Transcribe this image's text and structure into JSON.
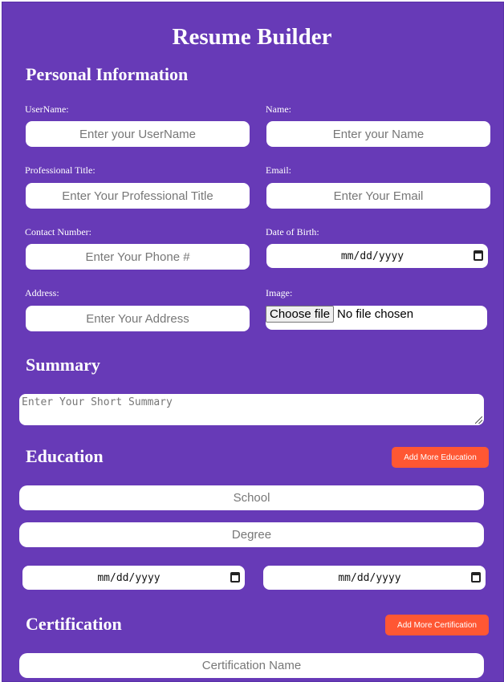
{
  "app": {
    "title": "Resume Builder"
  },
  "personal": {
    "heading": "Personal Information",
    "username": {
      "label": "UserName:",
      "placeholder": "Enter your UserName"
    },
    "name": {
      "label": "Name:",
      "placeholder": "Enter your Name"
    },
    "professional_title": {
      "label": "Professional Title:",
      "placeholder": "Enter Your Professional Title"
    },
    "email": {
      "label": "Email:",
      "placeholder": "Enter Your Email"
    },
    "contact": {
      "label": "Contact Number:",
      "placeholder": "Enter Your Phone #"
    },
    "dob": {
      "label": "Date of Birth:",
      "placeholder": "mm/dd/yyyy"
    },
    "address": {
      "label": "Address:",
      "placeholder": "Enter Your Address"
    },
    "image": {
      "label": "Image:",
      "button": "Choose file",
      "status": "No file chosen"
    }
  },
  "summary": {
    "heading": "Summary",
    "placeholder": "Enter Your Short Summary"
  },
  "education": {
    "heading": "Education",
    "add_button": "Add More Education",
    "school_placeholder": "School",
    "degree_placeholder": "Degree",
    "start_date": "mm/dd/yyyy",
    "end_date": "mm/dd/yyyy"
  },
  "certification": {
    "heading": "Certification",
    "add_button": "Add More Certification",
    "name_placeholder": "Certification Name"
  },
  "colors": {
    "background": "#673ab7",
    "accent_button": "#ff5733",
    "input_background": "#ffffff"
  },
  "icons": {
    "date_picker": "calendar-icon",
    "textarea_resize": "resize-grip-icon"
  }
}
